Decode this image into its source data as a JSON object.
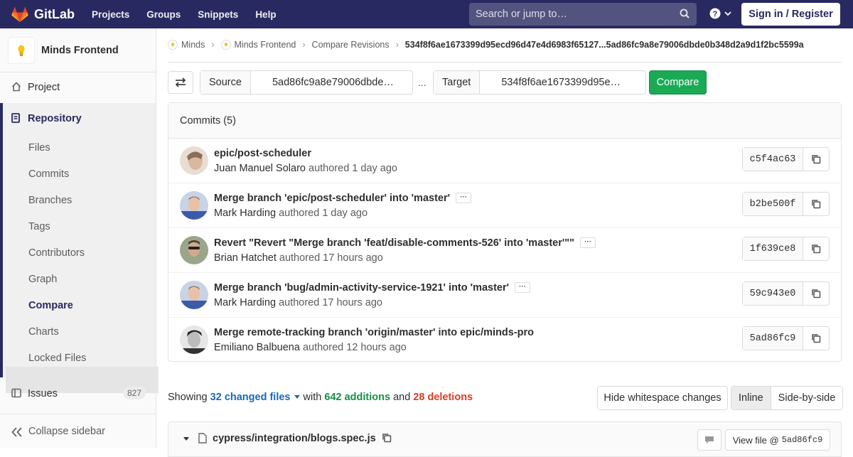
{
  "navbar": {
    "brand": "GitLab",
    "links": [
      "Projects",
      "Groups",
      "Snippets",
      "Help"
    ],
    "search_placeholder": "Search or jump to…",
    "signin_label": "Sign in / Register"
  },
  "sidebar": {
    "project_name": "Minds Frontend",
    "project_label": "Project",
    "repository_label": "Repository",
    "repo_items": [
      "Files",
      "Commits",
      "Branches",
      "Tags",
      "Contributors",
      "Graph",
      "Compare",
      "Charts",
      "Locked Files"
    ],
    "active_item": "Compare",
    "issues_label": "Issues",
    "issues_count": "827",
    "collapse_label": "Collapse sidebar"
  },
  "breadcrumb": {
    "items": [
      "Minds",
      "Minds Frontend",
      "Compare Revisions"
    ],
    "current": "534f8f6ae1673399d95ecd96d47e4d6983f65127...5ad86fc9a8e79006dbde0b348d2a9d1f2bc5599a"
  },
  "compare_form": {
    "source_label": "Source",
    "source_value": "5ad86fc9a8e79006dbde…",
    "separator": "...",
    "target_label": "Target",
    "target_value": "534f8f6ae1673399d95e…",
    "compare_label": "Compare"
  },
  "commits": {
    "header": "Commits (5)",
    "items": [
      {
        "title": "epic/post-scheduler",
        "author": "Juan Manuel Solaro",
        "meta": "authored 1 day ago",
        "sha": "c5f4ac63",
        "has_more": false
      },
      {
        "title": "Merge branch 'epic/post-scheduler' into 'master'",
        "author": "Mark Harding",
        "meta": "authored 1 day ago",
        "sha": "b2be500f",
        "has_more": true
      },
      {
        "title": "Revert \"Revert \"Merge branch 'feat/disable-comments-526' into 'master'\"\"",
        "author": "Brian Hatchet",
        "meta": "authored 17 hours ago",
        "sha": "1f639ce8",
        "has_more": true
      },
      {
        "title": "Merge branch 'bug/admin-activity-service-1921' into 'master'",
        "author": "Mark Harding",
        "meta": "authored 17 hours ago",
        "sha": "59c943e0",
        "has_more": true
      },
      {
        "title": "Merge remote-tracking branch 'origin/master' into epic/minds-pro",
        "author": "Emiliano Balbuena",
        "meta": "authored 12 hours ago",
        "sha": "5ad86fc9",
        "has_more": false
      }
    ]
  },
  "diff_summary": {
    "showing": "Showing",
    "files": "32 changed files",
    "with": "with",
    "additions": "642 additions",
    "and": "and",
    "deletions": "28 deletions",
    "whitespace_label": "Hide whitespace changes",
    "inline_label": "Inline",
    "side_label": "Side-by-side"
  },
  "file": {
    "name": "cypress/integration/blogs.spec.js",
    "view_label": "View file @",
    "view_sha": "5ad86fc9"
  },
  "colors": {
    "navbar": "#292961",
    "compare_button": "#1aaa55",
    "additions": "#168f48",
    "deletions": "#db3b21",
    "link": "#1b69b6"
  }
}
